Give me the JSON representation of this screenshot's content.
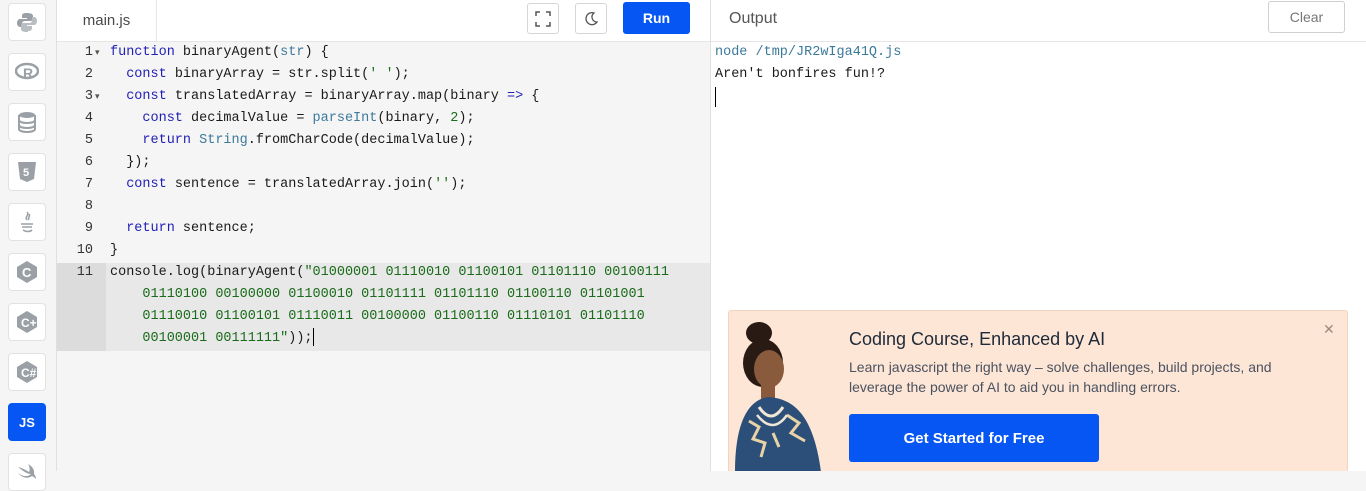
{
  "editor": {
    "file_tab": "main.js",
    "run_label": "Run",
    "lines": [
      {
        "n": "1",
        "fold": true
      },
      {
        "n": "2",
        "fold": false
      },
      {
        "n": "3",
        "fold": true
      },
      {
        "n": "4",
        "fold": false
      },
      {
        "n": "5",
        "fold": false
      },
      {
        "n": "6",
        "fold": false
      },
      {
        "n": "7",
        "fold": false
      },
      {
        "n": "8",
        "fold": false
      },
      {
        "n": "9",
        "fold": false
      },
      {
        "n": "10",
        "fold": false
      },
      {
        "n": "11",
        "fold": false
      }
    ],
    "code": {
      "l1": "function binaryAgent(str) {",
      "l2": "  const binaryArray = str.split(' ');",
      "l3": "  const translatedArray = binaryArray.map(binary => {",
      "l4": "    const decimalValue = parseInt(binary, 2);",
      "l5": "    return String.fromCharCode(decimalValue);",
      "l6": "  });",
      "l7": "  const sentence = translatedArray.join('');",
      "l8": "",
      "l9": "  return sentence;",
      "l10": "}",
      "l11a": "console.log(binaryAgent(\"01000001 01110010 01100101 01101110 00100111",
      "l11b": "    01110100 00100000 01100010 01101111 01101110 01100110 01101001",
      "l11c": "    01110010 01100101 01110011 00100000 01100110 01110101 01101110",
      "l11d": "    00100001 00111111\"));"
    }
  },
  "output": {
    "title": "Output",
    "clear_label": "Clear",
    "lines": [
      "node /tmp/JR2wIga41Q.js",
      "Aren't bonfires fun!?"
    ]
  },
  "ad": {
    "title": "Coding Course, Enhanced by AI",
    "text": "Learn javascript the right way – solve challenges, build projects, and leverage the power of AI to aid you in handling errors.",
    "cta": "Get Started for Free",
    "close": "✕"
  },
  "rail": {
    "items": [
      "python-icon",
      "r-icon",
      "database-icon",
      "html5-icon",
      "java-icon",
      "c-icon",
      "cpp-icon",
      "csharp-icon",
      "js-icon",
      "swift-icon"
    ],
    "active_label": "JS"
  },
  "colors": {
    "accent": "#0556f3",
    "ad_bg": "#fde6d6"
  }
}
